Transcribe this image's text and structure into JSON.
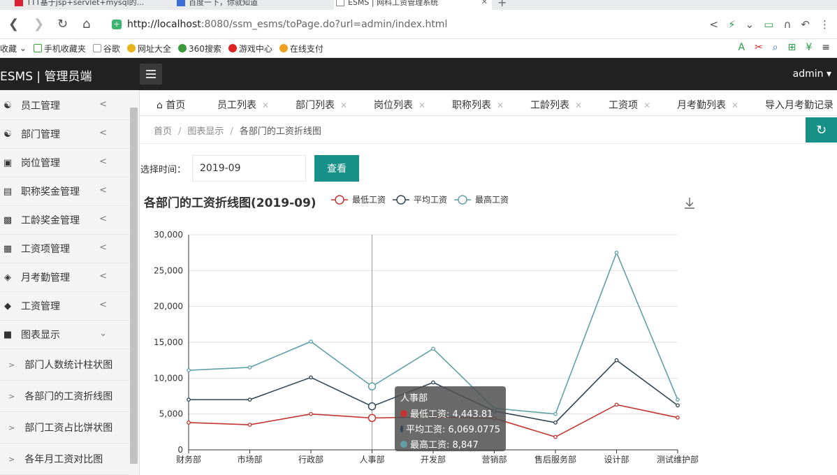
{
  "browser": {
    "tabs": [
      {
        "label": "TTT基于jsp+servlet+mysql的..."
      },
      {
        "label": "百度一下，你就知道"
      },
      {
        "label": "ESMS | 网科工资管理系统"
      }
    ],
    "url_host": "http://localhost",
    "url_rest": ":8080/ssm_esms/toPage.do?url=admin/index.html",
    "bookmarks": [
      "收藏",
      "手机收藏夹",
      "谷歌",
      "网址大全",
      "360搜索",
      "游戏中心",
      "在线支付"
    ]
  },
  "header": {
    "brand": "ESMS | 管理员端",
    "user": "admin"
  },
  "sidebar": {
    "items": [
      {
        "label": "员工管理",
        "icon": "users-icon"
      },
      {
        "label": "部门管理",
        "icon": "sitemap-icon"
      },
      {
        "label": "岗位管理",
        "icon": "id-card-icon"
      },
      {
        "label": "职称奖金管理",
        "icon": "briefcase-icon"
      },
      {
        "label": "工龄奖金管理",
        "icon": "industry-icon"
      },
      {
        "label": "工资项管理",
        "icon": "building-icon"
      },
      {
        "label": "月考勤管理",
        "icon": "layers-icon"
      },
      {
        "label": "工资管理",
        "icon": "tag-icon"
      },
      {
        "label": "图表显示",
        "icon": "book-icon"
      }
    ],
    "subitems": [
      {
        "label": "部门人数统计柱状图"
      },
      {
        "label": "各部门的工资折线图"
      },
      {
        "label": "部门工资占比饼状图"
      },
      {
        "label": "各年月工资对比图"
      }
    ]
  },
  "content_tabs": [
    {
      "label": "首页"
    },
    {
      "label": "员工列表"
    },
    {
      "label": "部门列表"
    },
    {
      "label": "岗位列表"
    },
    {
      "label": "职称列表"
    },
    {
      "label": "工龄列表"
    },
    {
      "label": "工资项"
    },
    {
      "label": "月考勤列表"
    },
    {
      "label": "导入月考勤记录"
    }
  ],
  "breadcrumb": {
    "home": "首页",
    "section": "图表显示",
    "current": "各部门的工资折线图"
  },
  "filter": {
    "label": "选择时间：",
    "value": "2019-09",
    "button": "查看"
  },
  "chart_data": {
    "type": "line",
    "title": "各部门的工资折线图(2019-09)",
    "categories": [
      "财务部",
      "市场部",
      "行政部",
      "人事部",
      "开发部",
      "营销部",
      "售后服务部",
      "设计部",
      "测试维护部"
    ],
    "series": [
      {
        "name": "最低工资",
        "color": "#c23531",
        "values": [
          3800,
          3500,
          5000,
          4443.81,
          4600,
          4400,
          1800,
          6300,
          4500
        ]
      },
      {
        "name": "平均工资",
        "color": "#2f4554",
        "values": [
          7000,
          7000,
          10100,
          6069.0775,
          9400,
          5400,
          3800,
          12500,
          6200
        ]
      },
      {
        "name": "最高工资",
        "color": "#61a0a8",
        "values": [
          11100,
          11500,
          15100,
          8847,
          14100,
          5800,
          5000,
          27500,
          7000
        ]
      }
    ],
    "ylim": [
      0,
      30000
    ],
    "yticks": [
      "0",
      "5,000",
      "10,000",
      "15,000",
      "20,000",
      "25,000",
      "30,000"
    ],
    "grid": true,
    "legend_position": "top"
  },
  "tooltip": {
    "title": "人事部",
    "rows": [
      {
        "text": "最低工资: 4,443.81",
        "color": "#c23531"
      },
      {
        "text": "平均工资: 6,069.0775",
        "color": "#2f4554"
      },
      {
        "text": "最高工资: 8,847",
        "color": "#61a0a8"
      }
    ]
  }
}
